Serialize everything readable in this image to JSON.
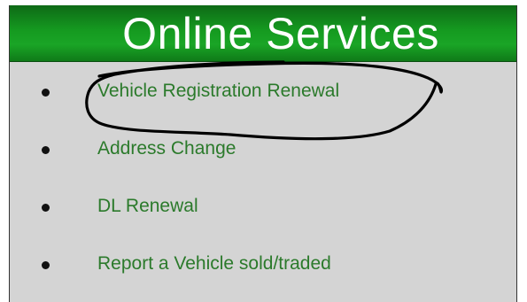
{
  "panel": {
    "title": "Online Services",
    "header_color": "#159a20",
    "link_color": "#2b7a2b",
    "background_color": "#d4d4d4"
  },
  "services": [
    {
      "label": "Vehicle Registration Renewal",
      "circled": true
    },
    {
      "label": "Address Change",
      "circled": false
    },
    {
      "label": "DL Renewal",
      "circled": false
    },
    {
      "label": "Report a Vehicle sold/traded",
      "circled": false
    }
  ],
  "annotation": {
    "type": "hand-drawn-circle",
    "color": "#000000"
  }
}
